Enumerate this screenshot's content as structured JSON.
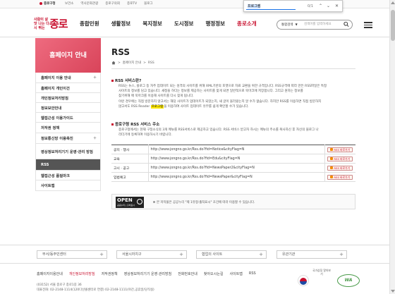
{
  "topbar": {
    "home_tab": "종로구청",
    "links": [
      "보건소",
      "역사문화관광",
      "종로구의회",
      "종로TV",
      "블로그"
    ]
  },
  "findbar": {
    "query": "프로그램",
    "count": "0/1",
    "prev": "⌃",
    "next": "⌄",
    "close": "✕"
  },
  "header": {
    "logo_sub": "사람이 살맛 나는 다시 뛰는",
    "logo_main": "종로",
    "gnb": [
      "종합민원",
      "생활정보",
      "복지정보",
      "도시정보",
      "행정정보",
      "종로소개"
    ],
    "search_select": "통합검색",
    "search_placeholder": "검색어를 입력하세요"
  },
  "sidebar": {
    "heading": "홈페이지 안내",
    "items": [
      {
        "label": "홈페이지 이용 안내",
        "plus": true,
        "active": false,
        "h": 15
      },
      {
        "label": "홈페이지 개인이건",
        "plus": false,
        "active": false,
        "h": 14
      },
      {
        "label": "개인정보처리방침",
        "plus": false,
        "active": false,
        "h": 14
      },
      {
        "label": "정보보안안내",
        "plus": false,
        "active": false,
        "h": 14
      },
      {
        "label": "웹접근성 이용가이드",
        "plus": false,
        "active": false,
        "h": 14
      },
      {
        "label": "저작권 정책",
        "plus": false,
        "active": false,
        "h": 15
      },
      {
        "label": "정보통신망 이용촉진",
        "plus": true,
        "active": false,
        "h": 15
      },
      {
        "label": "영상정보처리기기 운영·관리 방침",
        "plus": false,
        "active": false,
        "h": 22
      },
      {
        "label": "RSS",
        "plus": false,
        "active": true,
        "h": 16
      },
      {
        "label": "웹접근성 품질마크",
        "plus": false,
        "active": false,
        "h": 14
      },
      {
        "label": "사이트맵",
        "plus": false,
        "active": false,
        "h": 15
      }
    ]
  },
  "content": {
    "title": "RSS",
    "breadcrumb": [
      "홈페이지 안내",
      "RSS"
    ],
    "section1_title": "RSS 서비스란?",
    "section1_p1": "RSS는 뉴스, 블로그 등 자주 업데이트 되는 성격의 사이트를 위해 XML기반의 포맷으로 자료 교환을 위한 규격입니다. RSS규격에 따라 만든 RSS파일은 특정",
    "section1_p2": "사이트의 정보를 담고 있습니다. 새정을 하다는 정보를 제공하는 사이트를 찾게 되면 일반적으로 북마크에 저장합니다. 그리고 원하는 정보를",
    "section1_p3": "찾기위해 매 북마크를 이용해 사이트를 다시 찾게 됩니다.",
    "section1_p4": "이런 경우에는 직접 방문하지 않고서는 해당 사이트가 업데이트가 되었는지, 새 글이 올라왔는지 알 수가 없습니다. 하지만 RSS를 이용하면 직접 방문하지",
    "section1_p5_before": "않고서도 RSS Reader ",
    "section1_p5_hl": "프로그램",
    "section1_p5_after": "을 이용하여 사이트 업데이트 유무를 쉽게 확인할 수가 있습니다.",
    "section2_title": "종로구청 RSS 서비스 주소",
    "section2_p1": "종로구청에서는 현재 구정소식의 3개 메뉴를 RSS서비스로 제공하고 있습니다. RSS 서비스 받고자 하시는 메뉴의 주소를 복사하신 후 자신의 블로그 나",
    "section2_p2": "리더기에 등록하여 이용하시기 바랍니다.",
    "rss_rows": [
      {
        "cat": "공지 · 행사",
        "url": "http://www.jongno.go.kr/Rss.do?fid=Notice&cityFlag=N",
        "btn": "RSS 바로가기"
      },
      {
        "cat": "교육",
        "url": "http://www.jongno.go.kr/Rss.do?fid=Edu&cityFlag=N",
        "btn": "RSS 바로가기"
      },
      {
        "cat": "고시 · 공고",
        "url": "http://www.jongno.go.kr/Rss.do?fid=NewsPaper2&cityFlag=N",
        "btn": "RSS 바로가기"
      },
      {
        "cat": "입법예고",
        "url": "http://www.jongno.go.kr/Rss.do?fid=NewsPaper&cityFlag=N",
        "btn": "RSS 바로가기"
      }
    ],
    "license_logo": "OPEN",
    "license_logo_sub": "공공누리 | 출처표시",
    "license_text": "본 저작물은 공공누리 \"제 1유형:출처표시\" 조건에 따라 이용할 수 있습니다."
  },
  "family": [
    "부서/동주민센터",
    "서울시자치구",
    "협업의 사이트",
    "유관기관"
  ],
  "footer": {
    "links": [
      "홈페이지이용안내",
      "개인정보처리방침",
      "저작권정책",
      "영상정보처리기기 운영·관리방침",
      "전화번호안내",
      "찾아오시는길",
      "사이트맵",
      "RSS"
    ],
    "addr1": "(03152) 서울 종로구 종로1길 36",
    "addr2": "대표전화: 02-2148-1114(120다산콜센터로 연결) 02-2148-1111(야간,공휴일/당직실)",
    "cert": "국가상징 알아보기",
    "wa": "WA"
  }
}
